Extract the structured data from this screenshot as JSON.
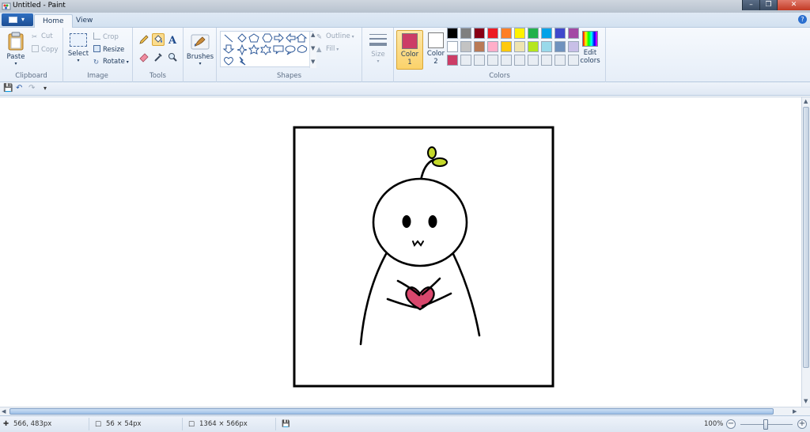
{
  "window": {
    "title": "Untitled - Paint",
    "app_icon": "paint-icon"
  },
  "tabs": [
    {
      "label": "Home"
    },
    {
      "label": "View"
    }
  ],
  "ribbon": {
    "clipboard": {
      "label": "Clipboard",
      "paste": "Paste",
      "cut": "Cut",
      "copy": "Copy"
    },
    "image": {
      "label": "Image",
      "select": "Select",
      "crop": "Crop",
      "resize": "Resize",
      "rotate": "Rotate"
    },
    "tools": {
      "label": "Tools",
      "active_tool": "fill-icon"
    },
    "brushes": {
      "label": "Brushes"
    },
    "shapes": {
      "label": "Shapes",
      "outline": "Outline",
      "fill": "Fill"
    },
    "size": {
      "label": "Size"
    },
    "colors": {
      "label": "Colors",
      "color1": {
        "label": "Color",
        "num": "1",
        "value": "#cc3d66"
      },
      "color2": {
        "label": "Color",
        "num": "2",
        "value": "#ffffff"
      },
      "edit": "Edit colors",
      "palette_row1": [
        "#000000",
        "#7f7f7f",
        "#880015",
        "#ed1c24",
        "#ff7f27",
        "#fff200",
        "#22b14c",
        "#00a2e8",
        "#3f48cc",
        "#a349a4"
      ],
      "palette_row2": [
        "#ffffff",
        "#c3c3c3",
        "#b97a57",
        "#ffaec9",
        "#ffc90e",
        "#efe4b0",
        "#b5e61d",
        "#99d9ea",
        "#7092be",
        "#c8bfe7"
      ],
      "palette_row3": [
        "#cc3d66",
        "#e8edf3",
        "#e8edf3",
        "#e8edf3",
        "#e8edf3",
        "#e8edf3",
        "#e8edf3",
        "#e8edf3",
        "#e8edf3",
        "#e8edf3"
      ]
    }
  },
  "status": {
    "cursor": "566, 483px",
    "selection": "56 × 54px",
    "image_size": "1364 × 566px",
    "zoom": "100%"
  },
  "drawing": {
    "heart_color": "#d9476d",
    "sprout_color": "#c4d82a"
  }
}
